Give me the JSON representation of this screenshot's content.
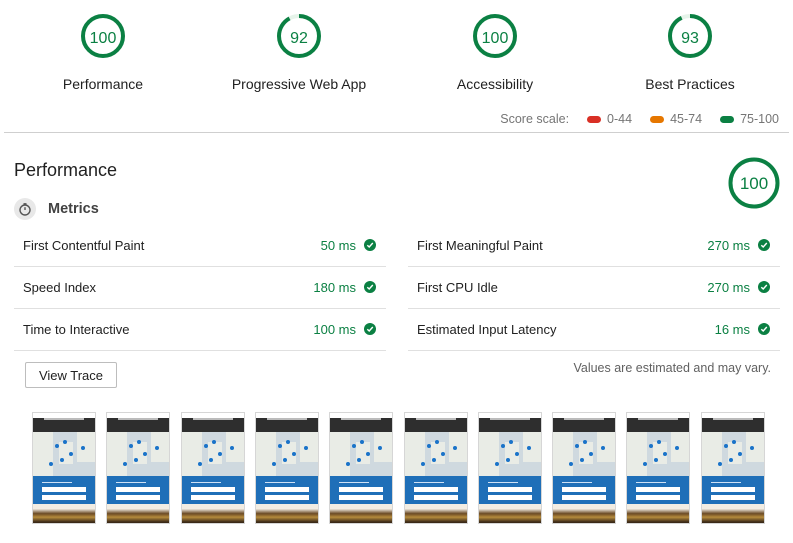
{
  "categories": [
    {
      "label": "Performance",
      "score": "100",
      "fraction": 1.0
    },
    {
      "label": "Progressive Web App",
      "score": "92",
      "fraction": 0.92
    },
    {
      "label": "Accessibility",
      "score": "100",
      "fraction": 1.0
    },
    {
      "label": "Best Practices",
      "score": "93",
      "fraction": 0.93
    }
  ],
  "score_scale": {
    "label": "Score scale:",
    "ranges": [
      {
        "label": "0-44",
        "color": "#d93025"
      },
      {
        "label": "45-74",
        "color": "#e67700"
      },
      {
        "label": "75-100",
        "color": "#0b8043"
      }
    ]
  },
  "performance": {
    "title": "Performance",
    "score": "100",
    "metrics_title": "Metrics",
    "metrics_left": [
      {
        "name": "First Contentful Paint",
        "value": "50 ms"
      },
      {
        "name": "Speed Index",
        "value": "180 ms"
      },
      {
        "name": "Time to Interactive",
        "value": "100 ms"
      }
    ],
    "metrics_right": [
      {
        "name": "First Meaningful Paint",
        "value": "270 ms"
      },
      {
        "name": "First CPU Idle",
        "value": "270 ms"
      },
      {
        "name": "Estimated Input Latency",
        "value": "16 ms"
      }
    ],
    "view_trace_label": "View Trace",
    "estimate_note": "Values are estimated and may vary.",
    "filmstrip_frames": 10
  },
  "colors": {
    "pass": "#0b8043",
    "ring_track": "#e6f4ea"
  }
}
